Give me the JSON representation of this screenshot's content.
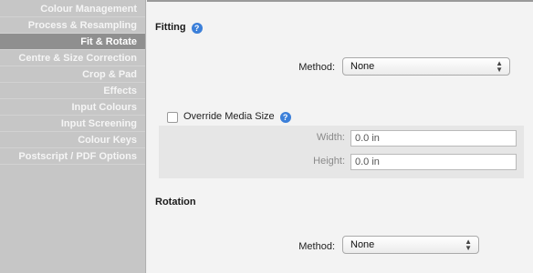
{
  "sidebar": {
    "items": [
      {
        "label": "Colour Management",
        "active": false
      },
      {
        "label": "Process & Resampling",
        "active": false
      },
      {
        "label": "Fit & Rotate",
        "active": true
      },
      {
        "label": "Centre & Size Correction",
        "active": false
      },
      {
        "label": "Crop & Pad",
        "active": false
      },
      {
        "label": "Effects",
        "active": false
      },
      {
        "label": "Input Colours",
        "active": false
      },
      {
        "label": "Input Screening",
        "active": false
      },
      {
        "label": "Colour Keys",
        "active": false
      },
      {
        "label": "Postscript / PDF Options",
        "active": false
      }
    ]
  },
  "fitting": {
    "title": "Fitting",
    "method_label": "Method:",
    "method_value": "None",
    "override": {
      "label": "Override Media Size",
      "checked": false,
      "width_label": "Width:",
      "width_value": "0.0 in",
      "height_label": "Height:",
      "height_value": "0.0 in"
    }
  },
  "rotation": {
    "title": "Rotation",
    "method_label": "Method:",
    "method_value": "None"
  },
  "colors": {
    "accent": "#3b7fd9",
    "sidebar_bg": "#c6c6c6",
    "sidebar_active": "#8f8f8f"
  }
}
